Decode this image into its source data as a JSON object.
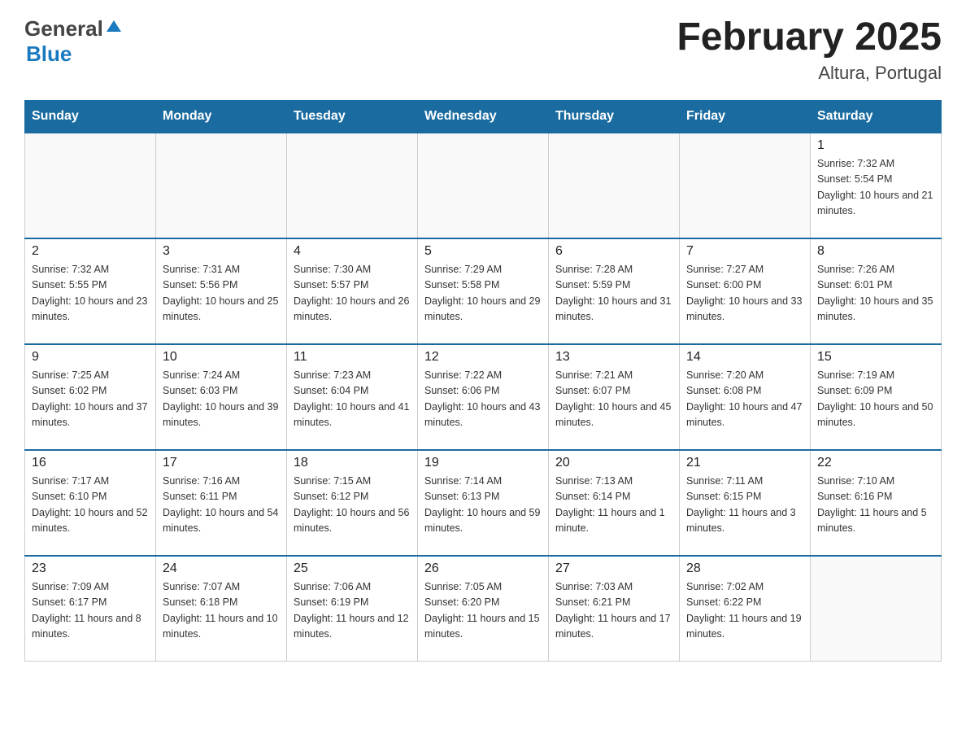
{
  "header": {
    "logo_general": "General",
    "logo_blue": "Blue",
    "title": "February 2025",
    "subtitle": "Altura, Portugal"
  },
  "calendar": {
    "days_of_week": [
      "Sunday",
      "Monday",
      "Tuesday",
      "Wednesday",
      "Thursday",
      "Friday",
      "Saturday"
    ],
    "weeks": [
      [
        {
          "day": "",
          "info": ""
        },
        {
          "day": "",
          "info": ""
        },
        {
          "day": "",
          "info": ""
        },
        {
          "day": "",
          "info": ""
        },
        {
          "day": "",
          "info": ""
        },
        {
          "day": "",
          "info": ""
        },
        {
          "day": "1",
          "info": "Sunrise: 7:32 AM\nSunset: 5:54 PM\nDaylight: 10 hours and 21 minutes."
        }
      ],
      [
        {
          "day": "2",
          "info": "Sunrise: 7:32 AM\nSunset: 5:55 PM\nDaylight: 10 hours and 23 minutes."
        },
        {
          "day": "3",
          "info": "Sunrise: 7:31 AM\nSunset: 5:56 PM\nDaylight: 10 hours and 25 minutes."
        },
        {
          "day": "4",
          "info": "Sunrise: 7:30 AM\nSunset: 5:57 PM\nDaylight: 10 hours and 26 minutes."
        },
        {
          "day": "5",
          "info": "Sunrise: 7:29 AM\nSunset: 5:58 PM\nDaylight: 10 hours and 29 minutes."
        },
        {
          "day": "6",
          "info": "Sunrise: 7:28 AM\nSunset: 5:59 PM\nDaylight: 10 hours and 31 minutes."
        },
        {
          "day": "7",
          "info": "Sunrise: 7:27 AM\nSunset: 6:00 PM\nDaylight: 10 hours and 33 minutes."
        },
        {
          "day": "8",
          "info": "Sunrise: 7:26 AM\nSunset: 6:01 PM\nDaylight: 10 hours and 35 minutes."
        }
      ],
      [
        {
          "day": "9",
          "info": "Sunrise: 7:25 AM\nSunset: 6:02 PM\nDaylight: 10 hours and 37 minutes."
        },
        {
          "day": "10",
          "info": "Sunrise: 7:24 AM\nSunset: 6:03 PM\nDaylight: 10 hours and 39 minutes."
        },
        {
          "day": "11",
          "info": "Sunrise: 7:23 AM\nSunset: 6:04 PM\nDaylight: 10 hours and 41 minutes."
        },
        {
          "day": "12",
          "info": "Sunrise: 7:22 AM\nSunset: 6:06 PM\nDaylight: 10 hours and 43 minutes."
        },
        {
          "day": "13",
          "info": "Sunrise: 7:21 AM\nSunset: 6:07 PM\nDaylight: 10 hours and 45 minutes."
        },
        {
          "day": "14",
          "info": "Sunrise: 7:20 AM\nSunset: 6:08 PM\nDaylight: 10 hours and 47 minutes."
        },
        {
          "day": "15",
          "info": "Sunrise: 7:19 AM\nSunset: 6:09 PM\nDaylight: 10 hours and 50 minutes."
        }
      ],
      [
        {
          "day": "16",
          "info": "Sunrise: 7:17 AM\nSunset: 6:10 PM\nDaylight: 10 hours and 52 minutes."
        },
        {
          "day": "17",
          "info": "Sunrise: 7:16 AM\nSunset: 6:11 PM\nDaylight: 10 hours and 54 minutes."
        },
        {
          "day": "18",
          "info": "Sunrise: 7:15 AM\nSunset: 6:12 PM\nDaylight: 10 hours and 56 minutes."
        },
        {
          "day": "19",
          "info": "Sunrise: 7:14 AM\nSunset: 6:13 PM\nDaylight: 10 hours and 59 minutes."
        },
        {
          "day": "20",
          "info": "Sunrise: 7:13 AM\nSunset: 6:14 PM\nDaylight: 11 hours and 1 minute."
        },
        {
          "day": "21",
          "info": "Sunrise: 7:11 AM\nSunset: 6:15 PM\nDaylight: 11 hours and 3 minutes."
        },
        {
          "day": "22",
          "info": "Sunrise: 7:10 AM\nSunset: 6:16 PM\nDaylight: 11 hours and 5 minutes."
        }
      ],
      [
        {
          "day": "23",
          "info": "Sunrise: 7:09 AM\nSunset: 6:17 PM\nDaylight: 11 hours and 8 minutes."
        },
        {
          "day": "24",
          "info": "Sunrise: 7:07 AM\nSunset: 6:18 PM\nDaylight: 11 hours and 10 minutes."
        },
        {
          "day": "25",
          "info": "Sunrise: 7:06 AM\nSunset: 6:19 PM\nDaylight: 11 hours and 12 minutes."
        },
        {
          "day": "26",
          "info": "Sunrise: 7:05 AM\nSunset: 6:20 PM\nDaylight: 11 hours and 15 minutes."
        },
        {
          "day": "27",
          "info": "Sunrise: 7:03 AM\nSunset: 6:21 PM\nDaylight: 11 hours and 17 minutes."
        },
        {
          "day": "28",
          "info": "Sunrise: 7:02 AM\nSunset: 6:22 PM\nDaylight: 11 hours and 19 minutes."
        },
        {
          "day": "",
          "info": ""
        }
      ]
    ]
  }
}
